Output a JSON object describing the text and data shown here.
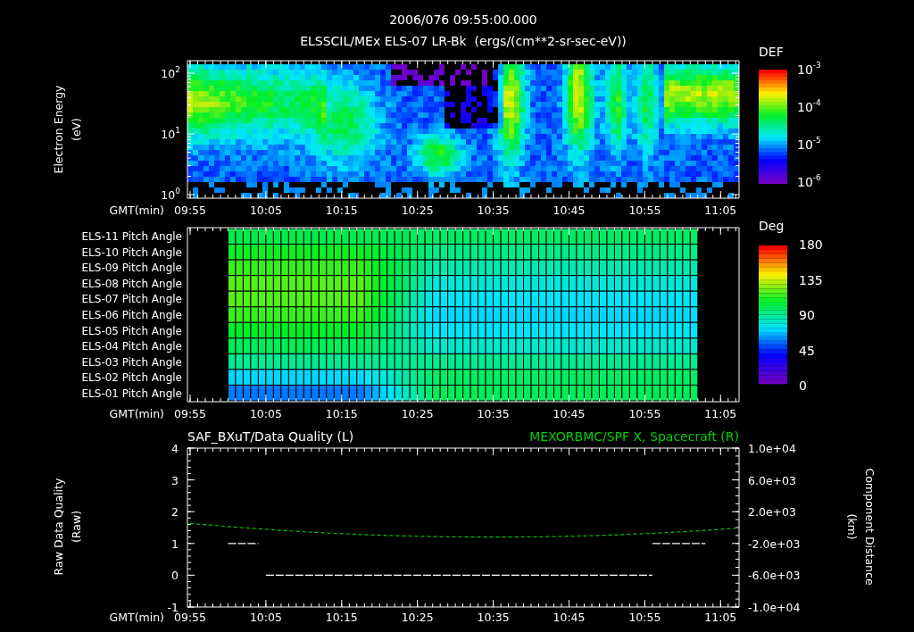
{
  "header": {
    "timestamp": "2006/076 09:55:00.000",
    "title": "ELSSCIL/MEx ELS-07 LR-Bk  (ergs/(cm**2-sr-sec-eV))"
  },
  "spectrogram_panel": {
    "ylabel": [
      "Electron Energy",
      "(eV)"
    ],
    "yticks": [
      {
        "base": "10",
        "exponent": "2"
      },
      {
        "base": "10",
        "exponent": "1"
      },
      {
        "base": "10",
        "exponent": "0"
      }
    ],
    "xaxis_label": "GMT(min)",
    "xticks": [
      "09:55",
      "10:05",
      "10:15",
      "10:25",
      "10:35",
      "10:45",
      "10:55",
      "11:05"
    ],
    "colorbar": {
      "title": "DEF",
      "labels": [
        {
          "base": "10",
          "exponent": "-3"
        },
        {
          "base": "10",
          "exponent": "-4"
        },
        {
          "base": "10",
          "exponent": "-5"
        },
        {
          "base": "10",
          "exponent": "-6"
        }
      ]
    }
  },
  "pitch_panel": {
    "rows": [
      "ELS-11 Pitch Angle",
      "ELS-10 Pitch Angle",
      "ELS-09 Pitch Angle",
      "ELS-08 Pitch Angle",
      "ELS-07 Pitch Angle",
      "ELS-06 Pitch Angle",
      "ELS-05 Pitch Angle",
      "ELS-04 Pitch Angle",
      "ELS-03 Pitch Angle",
      "ELS-02 Pitch Angle",
      "ELS-01 Pitch Angle"
    ],
    "xaxis_label": "GMT(min)",
    "xticks": [
      "09:55",
      "10:05",
      "10:15",
      "10:25",
      "10:35",
      "10:45",
      "10:55",
      "11:05"
    ],
    "colorbar": {
      "title": "Deg",
      "labels": [
        "180",
        "135",
        "90",
        "45",
        "0"
      ]
    }
  },
  "quality_panel": {
    "left_title": "SAF_BXuT/Data Quality (L)",
    "right_title": "MEXORBMC/SPF X, Spacecraft (R)",
    "ylabel": [
      "Raw Data Quality",
      "(Raw)"
    ],
    "ylabel_right": [
      "Component Distance",
      "(km)"
    ],
    "xaxis_label": "GMT(min)",
    "xticks": [
      "09:55",
      "10:05",
      "10:15",
      "10:25",
      "10:35",
      "10:45",
      "10:55",
      "11:05"
    ],
    "left_ticks": [
      "4",
      "3",
      "2",
      "1",
      "0",
      "-1"
    ],
    "right_ticks": [
      "1.0e+04",
      "6.0e+03",
      "2.0e+03",
      "-2.0e+03",
      "-6.0e+03",
      "-1.0e+04"
    ]
  }
}
